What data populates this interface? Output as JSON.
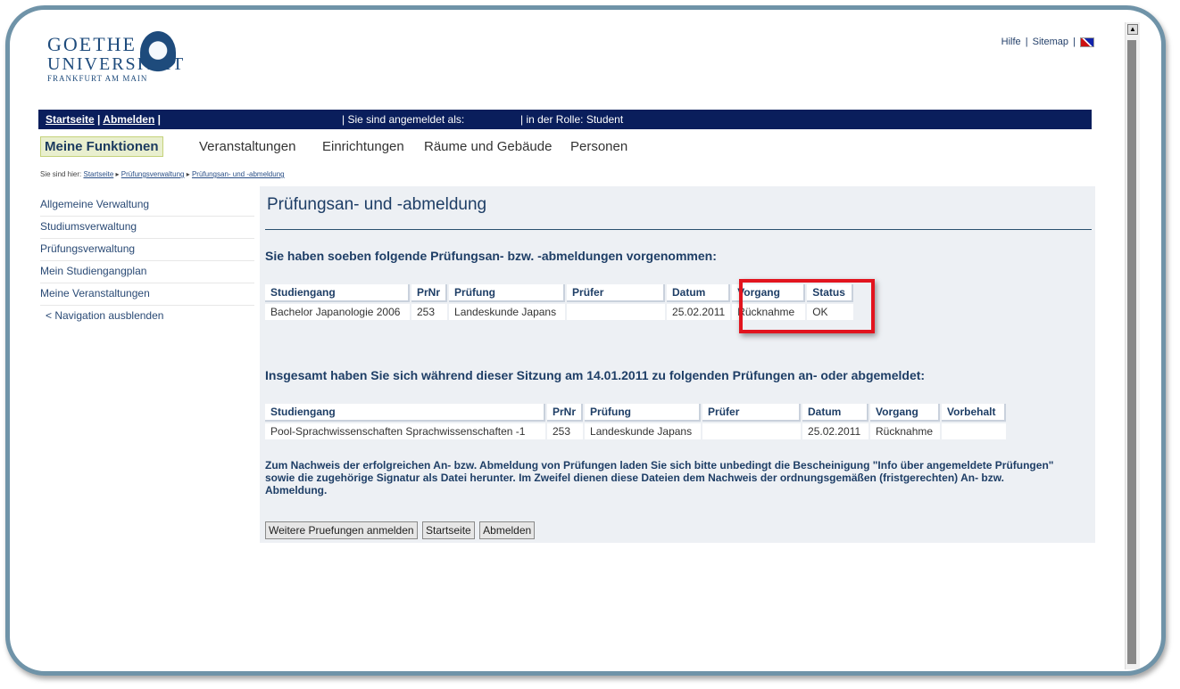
{
  "toplinks": {
    "help": "Hilfe",
    "sitemap": "Sitemap",
    "separator": "|",
    "language_icon": "uk-flag-icon"
  },
  "logo": {
    "line1": "GOETHE",
    "line2": "UNIVERSITÄT",
    "line3": "FRANKFURT AM MAIN"
  },
  "navbar": {
    "home": "Startseite",
    "logout": "Abmelden",
    "sep": "|",
    "logged_in_as": "| Sie sind angemeldet als:",
    "role": "| in der Rolle: Student"
  },
  "menu": {
    "active": "Meine Funktionen",
    "items": [
      "Veranstaltungen",
      "Einrichtungen",
      "Räume und Gebäude",
      "Personen"
    ]
  },
  "breadcrumb": {
    "prefix": "Sie sind hier:",
    "items": [
      "Startseite",
      "Prüfungsverwaltung",
      "Prüfungsan- und -abmeldung"
    ]
  },
  "sidebar": {
    "items": [
      "Allgemeine Verwaltung",
      "Studiumsverwaltung",
      "Prüfungsverwaltung",
      "Mein Studiengangplan",
      "Meine Veranstaltungen",
      "< Navigation ausblenden"
    ]
  },
  "page": {
    "title": "Prüfungsan- und -abmeldung",
    "section1_heading": "Sie haben soeben folgende Prüfungsan- bzw. -abmeldungen vorgenommen:",
    "table1": {
      "headers": [
        "Studiengang",
        "PrNr",
        "Prüfung",
        "Prüfer",
        "Datum",
        "Vorgang",
        "Status"
      ],
      "rows": [
        [
          "Bachelor Japanologie 2006",
          "253",
          "Landeskunde Japans",
          "",
          "25.02.2011",
          "Rücknahme",
          "OK"
        ]
      ]
    },
    "section2_heading": "Insgesamt haben Sie sich während dieser Sitzung am 14.01.2011 zu folgenden Prüfungen an- oder abgemeldet:",
    "table2": {
      "headers": [
        "Studiengang",
        "PrNr",
        "Prüfung",
        "Prüfer",
        "Datum",
        "Vorgang",
        "Vorbehalt"
      ],
      "rows": [
        [
          "Pool-Sprachwissenschaften Sprachwissenschaften -1",
          "253",
          "Landeskunde Japans",
          "",
          "25.02.2011",
          "Rücknahme",
          ""
        ]
      ]
    },
    "note": "Zum Nachweis der erfolgreichen An- bzw. Abmeldung von Prüfungen laden Sie sich bitte unbedingt die Bescheinigung \"Info über angemeldete Prüfungen\" sowie die zugehörige Signatur als Datei herunter. Im Zweifel dienen diese Dateien dem Nachweis der ordnungsgemäßen (fristgerechten) An- bzw. Abmeldung.",
    "buttons": {
      "more": "Weitere Pruefungen anmelden",
      "home": "Startseite",
      "logout": "Abmelden"
    }
  },
  "colors": {
    "navbar": "#0a1e5c",
    "highlight": "#e2141e",
    "frame": "#6f93a8"
  }
}
